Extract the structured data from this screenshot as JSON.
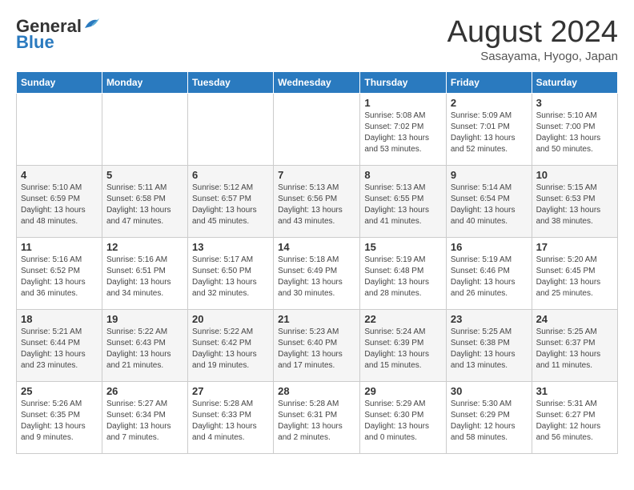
{
  "logo": {
    "line1": "General",
    "line2": "Blue"
  },
  "title": {
    "month_year": "August 2024",
    "location": "Sasayama, Hyogo, Japan"
  },
  "weekdays": [
    "Sunday",
    "Monday",
    "Tuesday",
    "Wednesday",
    "Thursday",
    "Friday",
    "Saturday"
  ],
  "weeks": [
    [
      {
        "day": "",
        "info": ""
      },
      {
        "day": "",
        "info": ""
      },
      {
        "day": "",
        "info": ""
      },
      {
        "day": "",
        "info": ""
      },
      {
        "day": "1",
        "info": "Sunrise: 5:08 AM\nSunset: 7:02 PM\nDaylight: 13 hours\nand 53 minutes."
      },
      {
        "day": "2",
        "info": "Sunrise: 5:09 AM\nSunset: 7:01 PM\nDaylight: 13 hours\nand 52 minutes."
      },
      {
        "day": "3",
        "info": "Sunrise: 5:10 AM\nSunset: 7:00 PM\nDaylight: 13 hours\nand 50 minutes."
      }
    ],
    [
      {
        "day": "4",
        "info": "Sunrise: 5:10 AM\nSunset: 6:59 PM\nDaylight: 13 hours\nand 48 minutes."
      },
      {
        "day": "5",
        "info": "Sunrise: 5:11 AM\nSunset: 6:58 PM\nDaylight: 13 hours\nand 47 minutes."
      },
      {
        "day": "6",
        "info": "Sunrise: 5:12 AM\nSunset: 6:57 PM\nDaylight: 13 hours\nand 45 minutes."
      },
      {
        "day": "7",
        "info": "Sunrise: 5:13 AM\nSunset: 6:56 PM\nDaylight: 13 hours\nand 43 minutes."
      },
      {
        "day": "8",
        "info": "Sunrise: 5:13 AM\nSunset: 6:55 PM\nDaylight: 13 hours\nand 41 minutes."
      },
      {
        "day": "9",
        "info": "Sunrise: 5:14 AM\nSunset: 6:54 PM\nDaylight: 13 hours\nand 40 minutes."
      },
      {
        "day": "10",
        "info": "Sunrise: 5:15 AM\nSunset: 6:53 PM\nDaylight: 13 hours\nand 38 minutes."
      }
    ],
    [
      {
        "day": "11",
        "info": "Sunrise: 5:16 AM\nSunset: 6:52 PM\nDaylight: 13 hours\nand 36 minutes."
      },
      {
        "day": "12",
        "info": "Sunrise: 5:16 AM\nSunset: 6:51 PM\nDaylight: 13 hours\nand 34 minutes."
      },
      {
        "day": "13",
        "info": "Sunrise: 5:17 AM\nSunset: 6:50 PM\nDaylight: 13 hours\nand 32 minutes."
      },
      {
        "day": "14",
        "info": "Sunrise: 5:18 AM\nSunset: 6:49 PM\nDaylight: 13 hours\nand 30 minutes."
      },
      {
        "day": "15",
        "info": "Sunrise: 5:19 AM\nSunset: 6:48 PM\nDaylight: 13 hours\nand 28 minutes."
      },
      {
        "day": "16",
        "info": "Sunrise: 5:19 AM\nSunset: 6:46 PM\nDaylight: 13 hours\nand 26 minutes."
      },
      {
        "day": "17",
        "info": "Sunrise: 5:20 AM\nSunset: 6:45 PM\nDaylight: 13 hours\nand 25 minutes."
      }
    ],
    [
      {
        "day": "18",
        "info": "Sunrise: 5:21 AM\nSunset: 6:44 PM\nDaylight: 13 hours\nand 23 minutes."
      },
      {
        "day": "19",
        "info": "Sunrise: 5:22 AM\nSunset: 6:43 PM\nDaylight: 13 hours\nand 21 minutes."
      },
      {
        "day": "20",
        "info": "Sunrise: 5:22 AM\nSunset: 6:42 PM\nDaylight: 13 hours\nand 19 minutes."
      },
      {
        "day": "21",
        "info": "Sunrise: 5:23 AM\nSunset: 6:40 PM\nDaylight: 13 hours\nand 17 minutes."
      },
      {
        "day": "22",
        "info": "Sunrise: 5:24 AM\nSunset: 6:39 PM\nDaylight: 13 hours\nand 15 minutes."
      },
      {
        "day": "23",
        "info": "Sunrise: 5:25 AM\nSunset: 6:38 PM\nDaylight: 13 hours\nand 13 minutes."
      },
      {
        "day": "24",
        "info": "Sunrise: 5:25 AM\nSunset: 6:37 PM\nDaylight: 13 hours\nand 11 minutes."
      }
    ],
    [
      {
        "day": "25",
        "info": "Sunrise: 5:26 AM\nSunset: 6:35 PM\nDaylight: 13 hours\nand 9 minutes."
      },
      {
        "day": "26",
        "info": "Sunrise: 5:27 AM\nSunset: 6:34 PM\nDaylight: 13 hours\nand 7 minutes."
      },
      {
        "day": "27",
        "info": "Sunrise: 5:28 AM\nSunset: 6:33 PM\nDaylight: 13 hours\nand 4 minutes."
      },
      {
        "day": "28",
        "info": "Sunrise: 5:28 AM\nSunset: 6:31 PM\nDaylight: 13 hours\nand 2 minutes."
      },
      {
        "day": "29",
        "info": "Sunrise: 5:29 AM\nSunset: 6:30 PM\nDaylight: 13 hours\nand 0 minutes."
      },
      {
        "day": "30",
        "info": "Sunrise: 5:30 AM\nSunset: 6:29 PM\nDaylight: 12 hours\nand 58 minutes."
      },
      {
        "day": "31",
        "info": "Sunrise: 5:31 AM\nSunset: 6:27 PM\nDaylight: 12 hours\nand 56 minutes."
      }
    ]
  ]
}
